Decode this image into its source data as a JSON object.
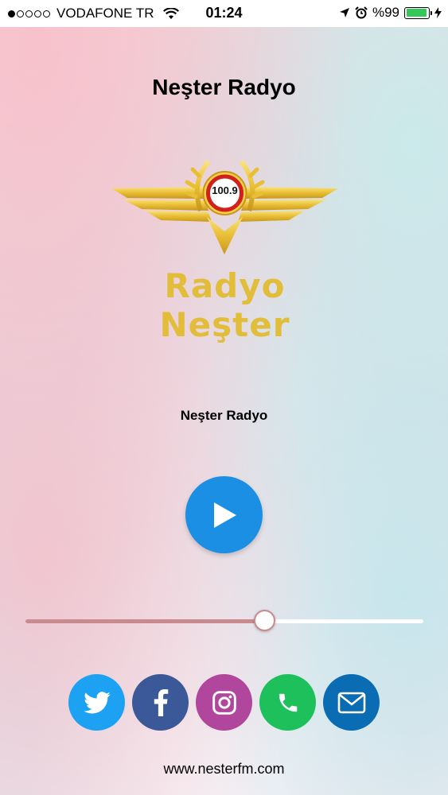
{
  "status_bar": {
    "carrier": "VODAFONE TR",
    "time": "01:24",
    "battery_text": "%99",
    "signal_bars_filled": 1,
    "signal_bars_total": 5,
    "battery_level": 0.99
  },
  "header": {
    "title": "Neşter Radyo"
  },
  "logo": {
    "frequency": "100.9",
    "brand_text": "Radyo  Neşter"
  },
  "player": {
    "station_name": "Neşter Radyo",
    "play_icon": "play-icon",
    "volume_level": 0.6
  },
  "social": {
    "items": [
      {
        "name": "twitter",
        "icon": "twitter-icon",
        "color": "#1da1f2"
      },
      {
        "name": "facebook",
        "icon": "facebook-icon",
        "color": "#3b5998"
      },
      {
        "name": "instagram",
        "icon": "instagram-icon",
        "color": "#b1469d"
      },
      {
        "name": "phone",
        "icon": "phone-icon",
        "color": "#1dc05a"
      },
      {
        "name": "email",
        "icon": "mail-icon",
        "color": "#0a6cb3"
      }
    ]
  },
  "footer": {
    "website": "www.nesterfm.com"
  },
  "colors": {
    "accent": "#1a8fe3",
    "slider": "#c98a8f",
    "logo_gold": "#e1bd3a"
  }
}
